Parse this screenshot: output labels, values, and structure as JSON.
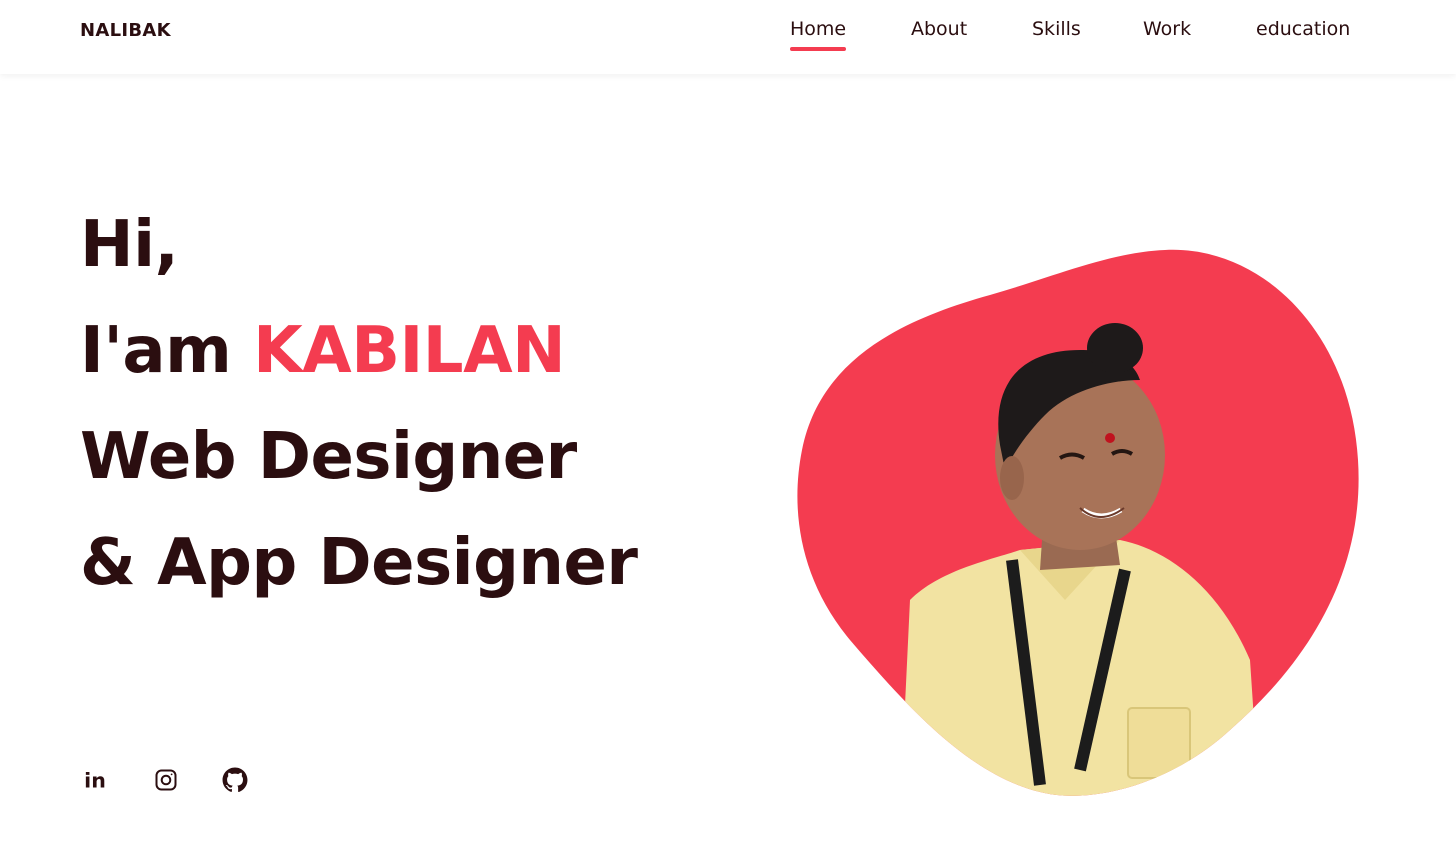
{
  "nav": {
    "logo": "NALIBAK",
    "links": [
      {
        "label": "Home",
        "active": true
      },
      {
        "label": "About",
        "active": false
      },
      {
        "label": "Skills",
        "active": false
      },
      {
        "label": "Work",
        "active": false
      },
      {
        "label": "education",
        "active": false
      }
    ]
  },
  "hero": {
    "greeting": "Hi,",
    "intro": "I'am ",
    "name": "KABILAN",
    "role1": "Web Designer",
    "role2": "& App Designer"
  },
  "socials": {
    "icons": [
      "linkedin-icon",
      "instagram-icon",
      "github-icon"
    ]
  },
  "colors": {
    "accent": "#f43c50",
    "text": "#2b0e10"
  }
}
